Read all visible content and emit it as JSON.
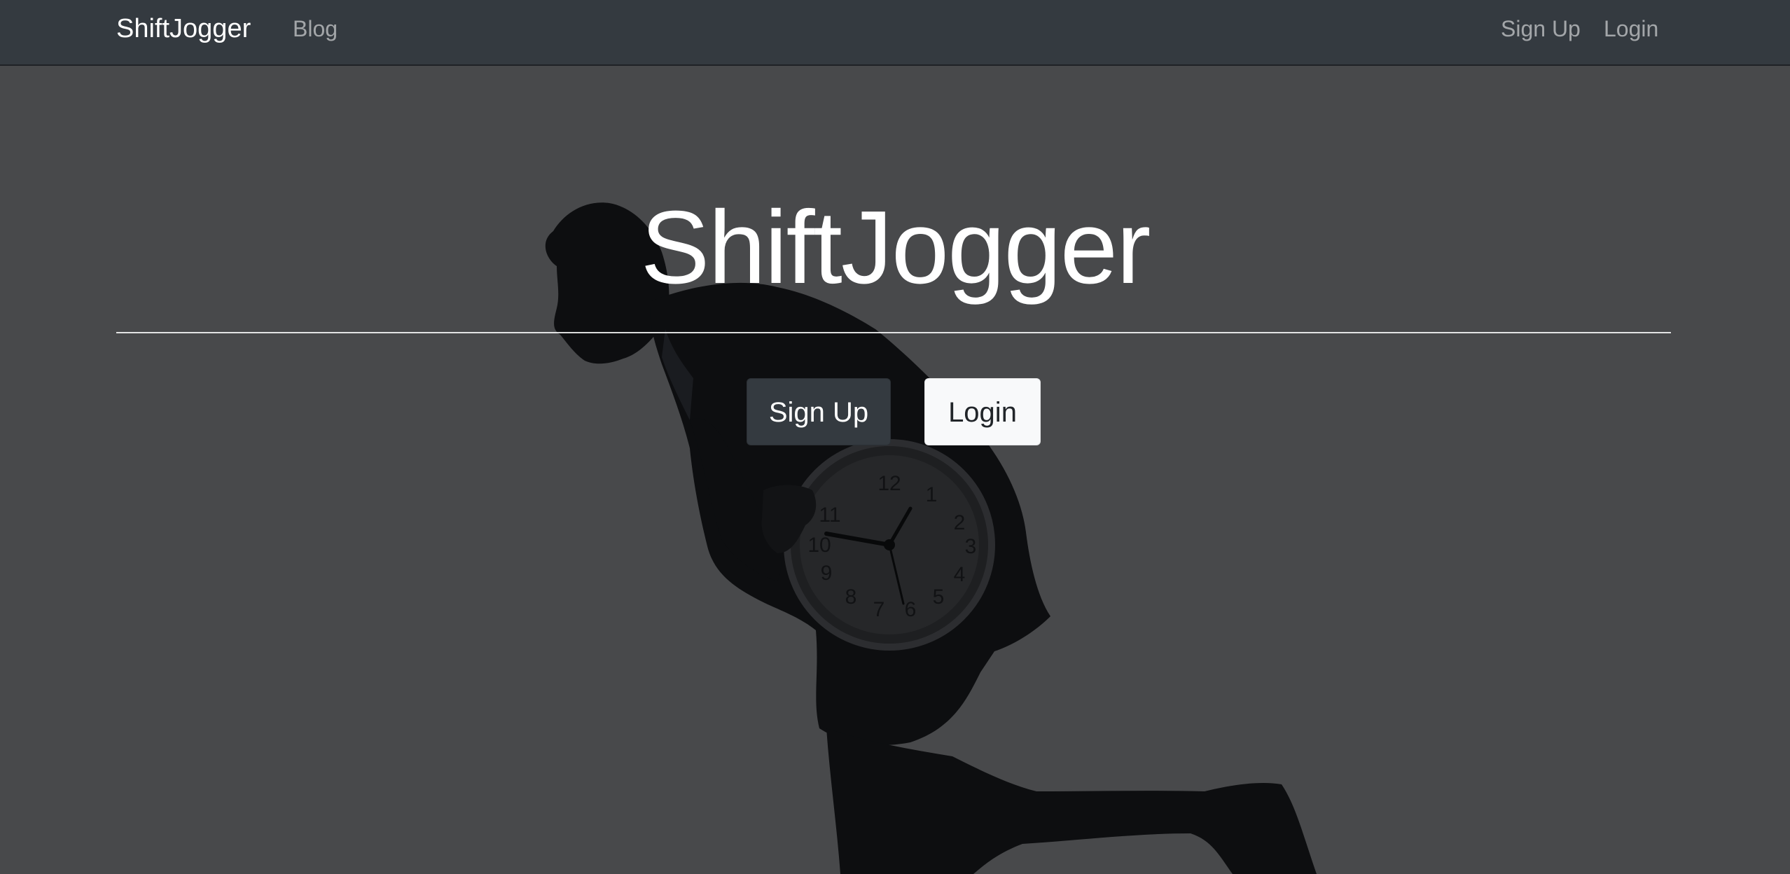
{
  "navbar": {
    "brand": "ShiftJogger",
    "links": {
      "blog": "Blog",
      "signup": "Sign Up",
      "login": "Login"
    },
    "background_color": "#343a40"
  },
  "hero": {
    "title": "ShiftJogger",
    "buttons": {
      "signup": "Sign Up",
      "login": "Login"
    },
    "background_image": "silhouette of a running businessman carrying a wall clock",
    "overlay_color": "#48494b"
  }
}
